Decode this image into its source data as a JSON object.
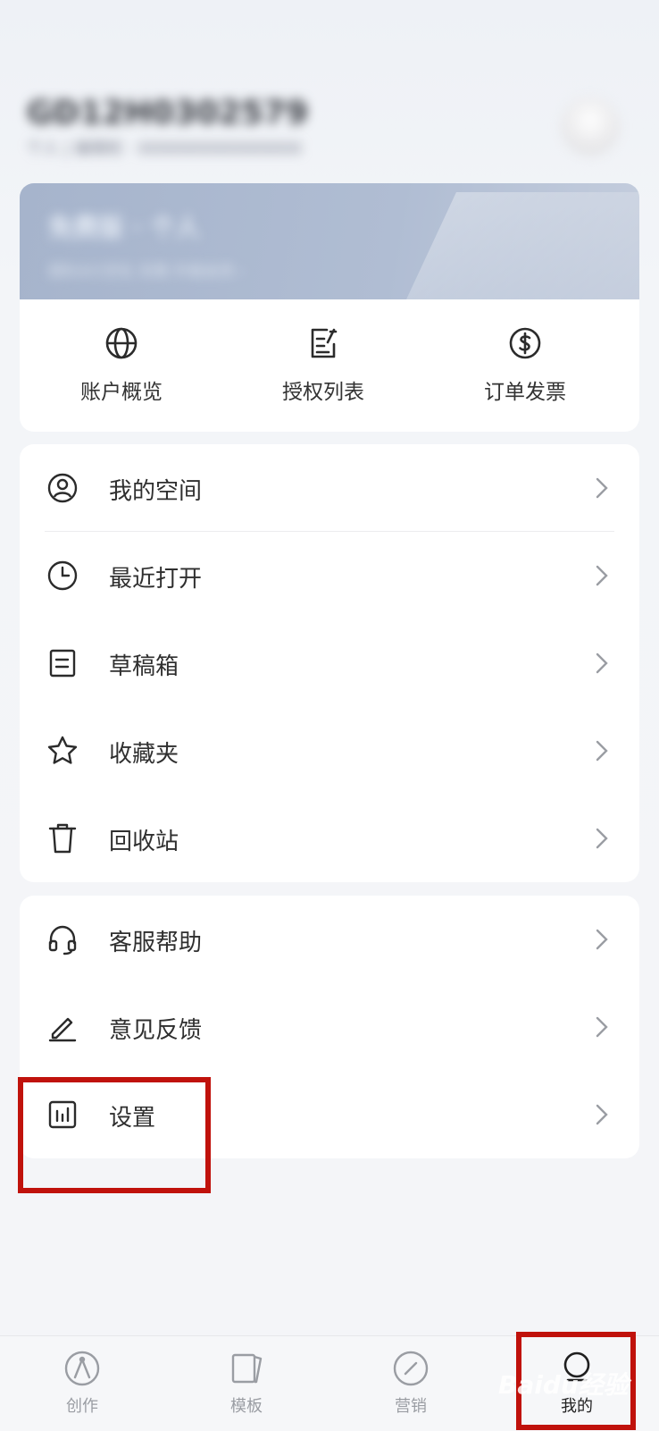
{
  "profile": {
    "username": "GD12H0302579",
    "subtitle": "个人 | 编辑权 · 0000000000000000"
  },
  "plan": {
    "title": "免费版 · 个人",
    "subtitle": "团队0/1空位   无限   升级会员 ›"
  },
  "quick_actions": [
    {
      "label": "账户概览",
      "icon": "globe-icon"
    },
    {
      "label": "授权列表",
      "icon": "document-edit-icon"
    },
    {
      "label": "订单发票",
      "icon": "dollar-circle-icon"
    }
  ],
  "menu_group_1": [
    {
      "label": "我的空间",
      "icon": "user-circle-icon"
    },
    {
      "label": "最近打开",
      "icon": "clock-icon"
    },
    {
      "label": "草稿箱",
      "icon": "draft-box-icon"
    },
    {
      "label": "收藏夹",
      "icon": "star-icon"
    },
    {
      "label": "回收站",
      "icon": "trash-icon"
    }
  ],
  "menu_group_2": [
    {
      "label": "客服帮助",
      "icon": "headset-icon"
    },
    {
      "label": "意见反馈",
      "icon": "pencil-icon"
    },
    {
      "label": "设置",
      "icon": "settings-chart-icon"
    }
  ],
  "tabs": [
    {
      "label": "创作",
      "icon": "create-icon",
      "active": false
    },
    {
      "label": "模板",
      "icon": "template-icon",
      "active": false
    },
    {
      "label": "营销",
      "icon": "marketing-icon",
      "active": false
    },
    {
      "label": "我的",
      "icon": "profile-icon",
      "active": true
    }
  ],
  "colors": {
    "highlight": "#c0120c",
    "plan_banner": "#a6b4cc",
    "background": "#f4f5f8"
  },
  "watermark": "Baidu经验"
}
